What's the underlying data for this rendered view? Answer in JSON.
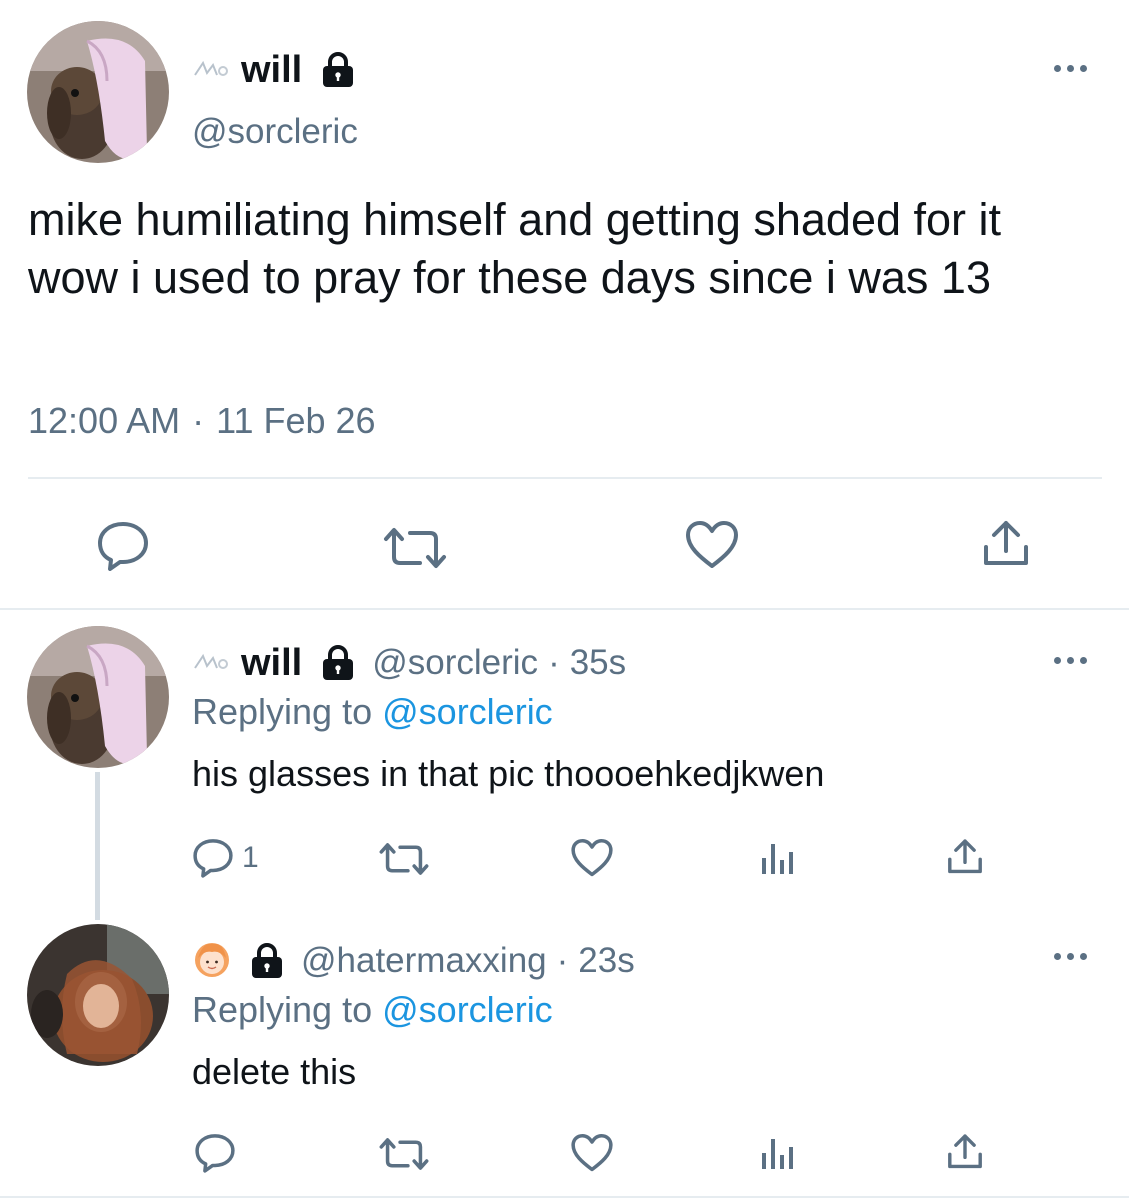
{
  "main_tweet": {
    "author": {
      "name": "will",
      "handle": "@sorcleric"
    },
    "text": "mike humiliating himself and getting shaded for it wow i used to pray for these days since i was 13",
    "time": "12:00 AM",
    "separator": "·",
    "date": "11 Feb 26"
  },
  "replies": [
    {
      "name": "will",
      "handle": "@sorcleric",
      "separator": "·",
      "age": "35s",
      "replying_label": "Replying to",
      "replying_to": "@sorcleric",
      "text": "his glasses in that pic thoooehkedjkwen",
      "reply_count": "1"
    },
    {
      "name": "",
      "handle": "@hatermaxxing",
      "separator": "·",
      "age": "23s",
      "replying_label": "Replying to",
      "replying_to": "@sorcleric",
      "text": "delete this",
      "reply_count": ""
    }
  ],
  "icons": {
    "reply": "reply-icon",
    "retweet": "retweet-icon",
    "like": "like-icon",
    "share": "share-icon",
    "analytics": "analytics-icon",
    "lock": "lock-icon",
    "more": "more-icon"
  },
  "colors": {
    "text": "#0f1419",
    "muted": "#5b7083",
    "link": "#1b95e0",
    "divider": "#e6ecf0"
  }
}
